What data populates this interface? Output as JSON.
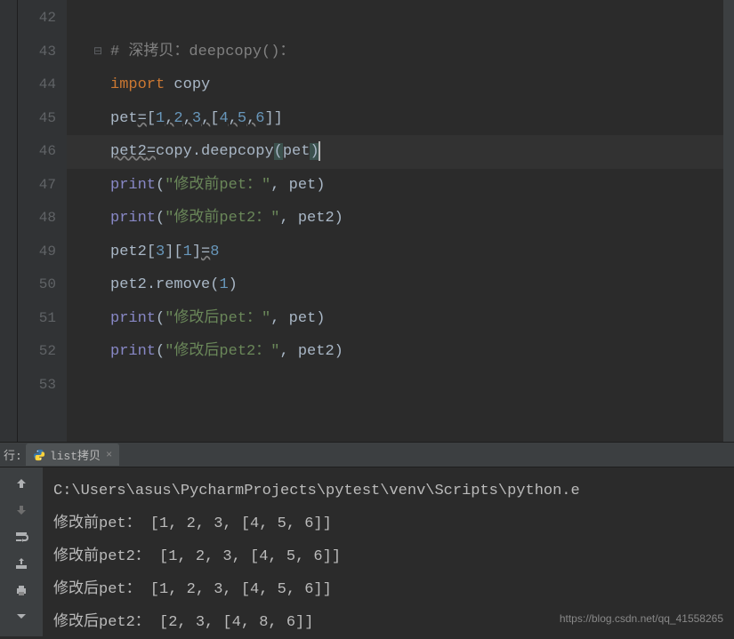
{
  "editor": {
    "lines": [
      {
        "num": "42",
        "content": ""
      },
      {
        "num": "43",
        "content": "comment"
      },
      {
        "num": "44",
        "content": "import"
      },
      {
        "num": "45",
        "content": "pet_assign"
      },
      {
        "num": "46",
        "content": "pet2_assign",
        "current": true
      },
      {
        "num": "47",
        "content": "print1"
      },
      {
        "num": "48",
        "content": "print2"
      },
      {
        "num": "49",
        "content": "index_assign"
      },
      {
        "num": "50",
        "content": "remove"
      },
      {
        "num": "51",
        "content": "print3"
      },
      {
        "num": "52",
        "content": "print4"
      },
      {
        "num": "53",
        "content": ""
      }
    ],
    "comment_text": "# 深拷贝：deepcopy()：",
    "import_kw": "import",
    "import_mod": " copy",
    "pet_var": "pet",
    "assign_op": "=",
    "list_open": "[",
    "list_close": "]",
    "nums": {
      "n1": "1",
      "n2": "2",
      "n3": "3",
      "n4": "4",
      "n5": "5",
      "n6": "6",
      "n8": "8"
    },
    "comma": ",",
    "pet2_var": "pet2",
    "copy_mod": "copy",
    "dot": ".",
    "deepcopy_fn": "deepcopy",
    "paren_open": "(",
    "paren_close": ")",
    "pet_ref": "pet",
    "print_fn": "print",
    "str1": "\"修改前pet：\"",
    "str2": "\"修改前pet2：\"",
    "str3": "\"修改后pet：\"",
    "str4": "\"修改后pet2：\"",
    "comma_sp": ", ",
    "pet2_ref": "pet2",
    "idx3": "3",
    "idx1": "1",
    "remove_fn": "remove"
  },
  "run": {
    "label": "行:",
    "tab_name": "list拷贝",
    "output": {
      "line1": "C:\\Users\\asus\\PycharmProjects\\pytest\\venv\\Scripts\\python.e",
      "line2": "修改前pet： [1, 2, 3, [4, 5, 6]]",
      "line3": "修改前pet2： [1, 2, 3, [4, 5, 6]]",
      "line4": "修改后pet： [1, 2, 3, [4, 5, 6]]",
      "line5": "修改后pet2： [2, 3, [4, 8, 6]]"
    }
  },
  "watermark": "https://blog.csdn.net/qq_41558265"
}
